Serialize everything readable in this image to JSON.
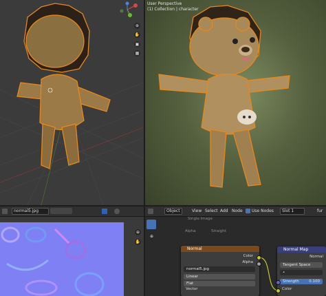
{
  "viewport_right": {
    "perspective": "User Perspective",
    "collection": "(1) Collection | character"
  },
  "image_editor": {
    "filename": "normal5.jpg"
  },
  "node_editor": {
    "object_menu": "Object",
    "menus": [
      "View",
      "Select",
      "Add",
      "Node"
    ],
    "use_nodes_label": "Use Nodes",
    "slot": "Slot 1",
    "partial_right": "fur",
    "bg_texts": {
      "single_image": "Single Image",
      "alpha": "Alpha",
      "straight": "Straight"
    },
    "image_node": {
      "title": "Normal",
      "out_color": "Color",
      "out_alpha": "Alpha",
      "image_name": "normal5.jpg",
      "interpolation": "Linear",
      "projection": "Flat",
      "in_vector": "Vector"
    },
    "normal_map_node": {
      "title": "Normal Map",
      "out_normal": "Normal",
      "space": "Tangent Space",
      "uvmap": "•",
      "strength_label": "Strength",
      "strength_value": "0.100",
      "in_color": "Color"
    }
  },
  "colors": {
    "selection_outline": "#e8881a",
    "image_node_header": "#7a4a1e",
    "normal_map_header": "#3a3f7a",
    "socket_yellow": "#c7c729",
    "socket_purple": "#6363c7",
    "socket_grey": "#a1a1a1"
  },
  "icons": [
    "zoom-icon",
    "hand-icon",
    "camera-icon",
    "grid-icon",
    "cursor-icon",
    "gizmo-axes-icon"
  ]
}
